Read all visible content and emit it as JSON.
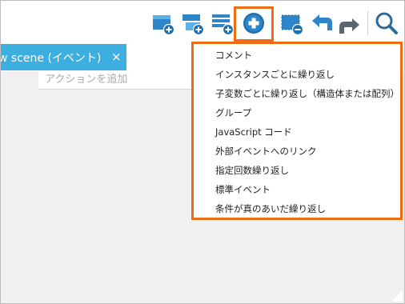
{
  "toolbar": {
    "buttons": [
      {
        "name": "add-event-button",
        "icon": "add-event-icon"
      },
      {
        "name": "add-subevent-button",
        "icon": "add-subevent-icon"
      },
      {
        "name": "add-list-event-button",
        "icon": "add-list-event-icon"
      },
      {
        "name": "add-other-button",
        "icon": "plus-circle-icon"
      },
      {
        "name": "delete-event-button",
        "icon": "delete-event-icon"
      },
      {
        "name": "undo-button",
        "icon": "undo-icon"
      },
      {
        "name": "redo-button",
        "icon": "redo-icon"
      },
      {
        "name": "search-button",
        "icon": "search-icon"
      }
    ],
    "highlight_color": "#ee6c12"
  },
  "tab": {
    "title": "w scene (イベント)",
    "close": "×",
    "color": "#3daee0"
  },
  "action": {
    "placeholder": "アクションを追加"
  },
  "menu": {
    "items": [
      "コメント",
      "インスタンスごとに繰り返し",
      "子変数ごとに繰り返し（構造体または配列）",
      "グループ",
      "JavaScript コード",
      "外部イベントへのリンク",
      "指定回数繰り返し",
      "標準イベント",
      "条件が真のあいだ繰り返し"
    ],
    "border_color": "#ee6c12"
  }
}
